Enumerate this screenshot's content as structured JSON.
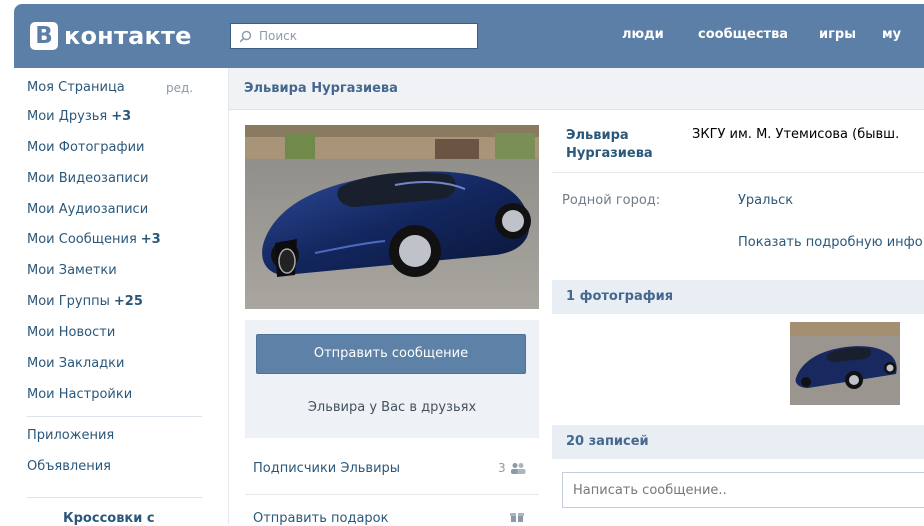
{
  "header": {
    "logo_letter": "В",
    "logo_text": "контакте",
    "search_placeholder": "Поиск",
    "nav": [
      "люди",
      "сообщества",
      "игры",
      "му"
    ]
  },
  "left_menu": {
    "items": [
      {
        "label": "Моя Страница",
        "count": ""
      },
      {
        "label": "Мои Друзья",
        "count": "+3"
      },
      {
        "label": "Мои Фотографии",
        "count": ""
      },
      {
        "label": "Мои Видеозаписи",
        "count": ""
      },
      {
        "label": "Мои Аудиозаписи",
        "count": ""
      },
      {
        "label": "Мои Сообщения",
        "count": "+3"
      },
      {
        "label": "Мои Заметки",
        "count": ""
      },
      {
        "label": "Мои Группы",
        "count": "+25"
      },
      {
        "label": "Мои Новости",
        "count": ""
      },
      {
        "label": "Мои Закладки",
        "count": ""
      },
      {
        "label": "Мои Настройки",
        "count": ""
      }
    ],
    "edit_label": "ред.",
    "extra_items": [
      "Приложения",
      "Объявления"
    ],
    "ad_title": "Кроссовки с"
  },
  "profile": {
    "name": "Эльвира Нургазиева",
    "name_line1": "Эльвира",
    "name_line2": "Нургазиева",
    "university": "ЗКГУ им. М. Утемисова (бывш.",
    "hometown_label": "Родной город:",
    "hometown_value": "Уральск",
    "show_more": "Показать подробную инфо"
  },
  "actions": {
    "send_message": "Отправить сообщение",
    "friend_status": "Эльвира у Вас в друзьях",
    "subscribers": "Подписчики Эльвиры",
    "subscribers_count": "3",
    "send_gift": "Отправить подарок"
  },
  "sections": {
    "photos": "1 фотография",
    "posts": "20 записей",
    "compose_placeholder": "Написать сообщение.."
  },
  "colors": {
    "header": "#5b7fa6",
    "link": "#2b587a",
    "button": "#5e81a8"
  }
}
